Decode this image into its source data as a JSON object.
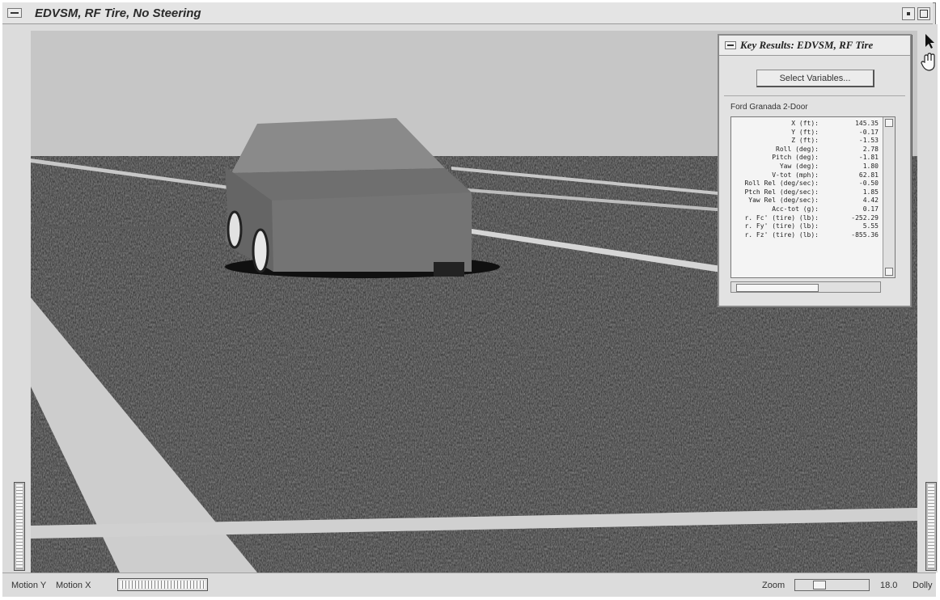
{
  "window": {
    "title": "EDVSM, RF Tire, No Steering"
  },
  "results_panel": {
    "title": "Key Results: EDVSM, RF Tire",
    "select_button": "Select Variables...",
    "vehicle": "Ford Granada 2-Door",
    "rows": [
      {
        "label": "X (ft):",
        "value": "145.35"
      },
      {
        "label": "Y (ft):",
        "value": "-0.17"
      },
      {
        "label": "Z (ft):",
        "value": "-1.53"
      },
      {
        "label": "Roll (deg):",
        "value": "2.78"
      },
      {
        "label": "Pitch (deg):",
        "value": "-1.81"
      },
      {
        "label": "Yaw (deg):",
        "value": "1.80"
      },
      {
        "label": "V-tot (mph):",
        "value": "62.81"
      },
      {
        "label": "Roll Rel (deg/sec):",
        "value": "-0.50"
      },
      {
        "label": "Ptch Rel (deg/sec):",
        "value": "1.85"
      },
      {
        "label": "Yaw Rel (deg/sec):",
        "value": "4.42"
      },
      {
        "label": "Acc-tot (g):",
        "value": "0.17"
      },
      {
        "label": "r. Fc' (tire) (lb):",
        "value": "-252.29"
      },
      {
        "label": "r. Fy' (tire) (lb):",
        "value": "5.55"
      },
      {
        "label": "r. Fz' (tire) (lb):",
        "value": "-855.36"
      }
    ]
  },
  "status": {
    "motion_y": "Motion Y",
    "motion_x": "Motion X",
    "zoom_label": "Zoom",
    "zoom_value": "18.0",
    "dolly_label": "Dolly"
  },
  "colors": {
    "sky": "#c6c6c6",
    "ground": "#262626",
    "lane_lines": "#cfcfcf",
    "car_body": "#707070"
  },
  "icons": {
    "pointer": "arrow-pointer-icon",
    "pan": "hand-icon",
    "window_menu": "window-menu-icon"
  }
}
